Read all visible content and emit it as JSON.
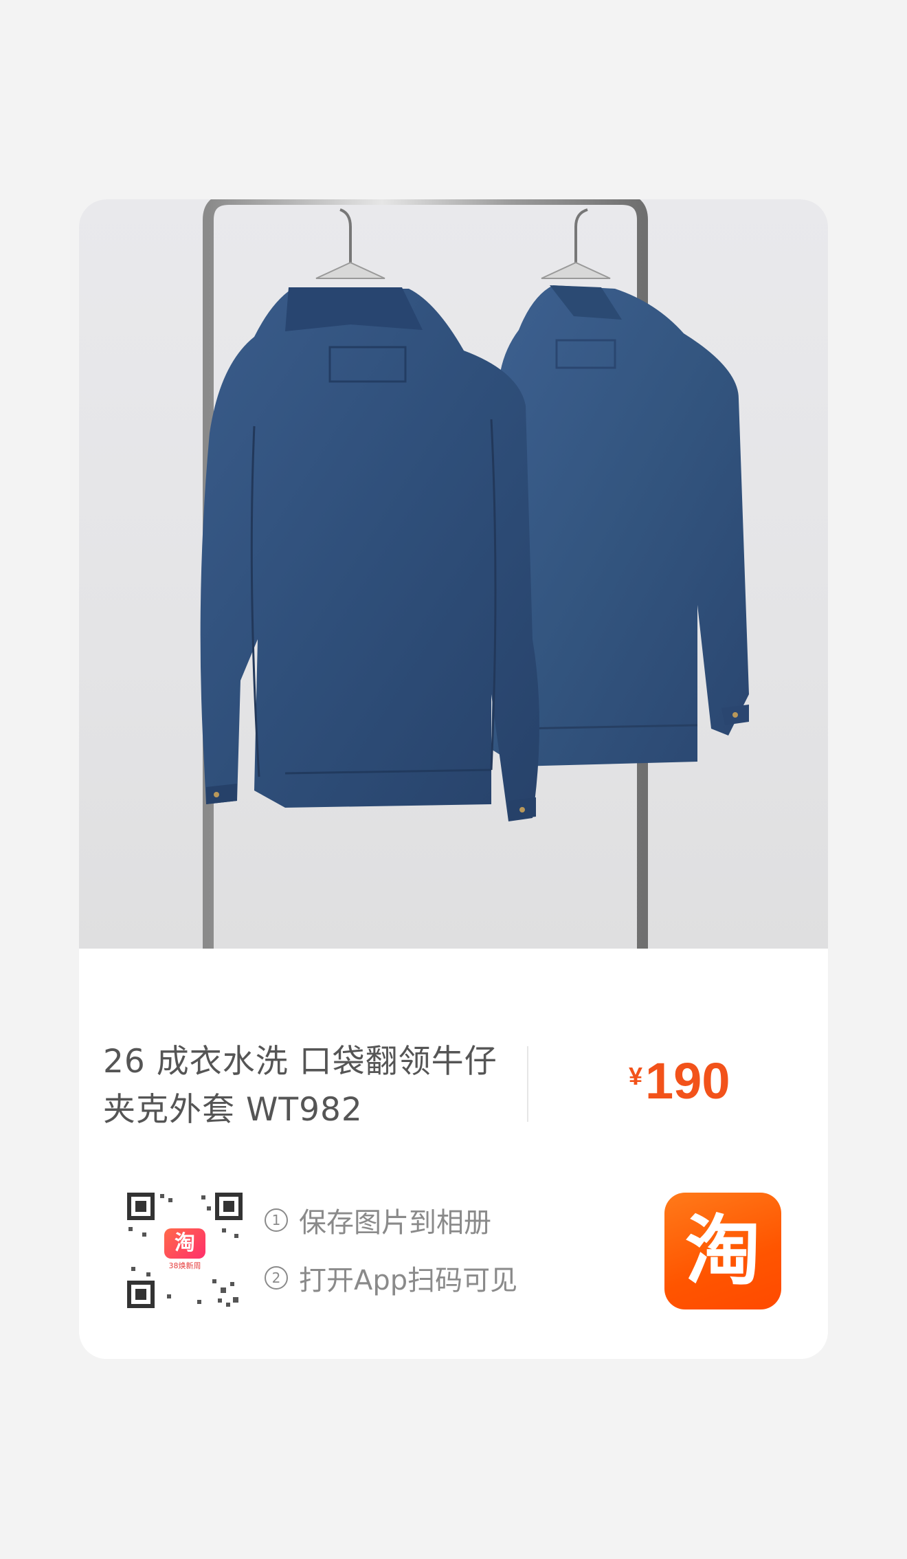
{
  "product": {
    "title_line1": "26 成衣水洗 口袋翻领牛仔",
    "title_line2": "夹克外套 WT982",
    "price_currency": "¥",
    "price_amount": "190",
    "image_alt": "两件深蓝色水洗牛仔夹克背面挂在金属衣架上"
  },
  "qr": {
    "logo_char": "淘",
    "logo_tag": "38焕新周"
  },
  "steps": [
    {
      "num": "1",
      "text": "保存图片到相册"
    },
    {
      "num": "2",
      "text": "打开App扫码可见"
    }
  ],
  "app_icon": {
    "char": "淘"
  },
  "colors": {
    "price": "#f2521a",
    "app_icon_bg": "#ff5500",
    "page_bg": "#f3f3f3",
    "denim": "#2f4f7a"
  }
}
